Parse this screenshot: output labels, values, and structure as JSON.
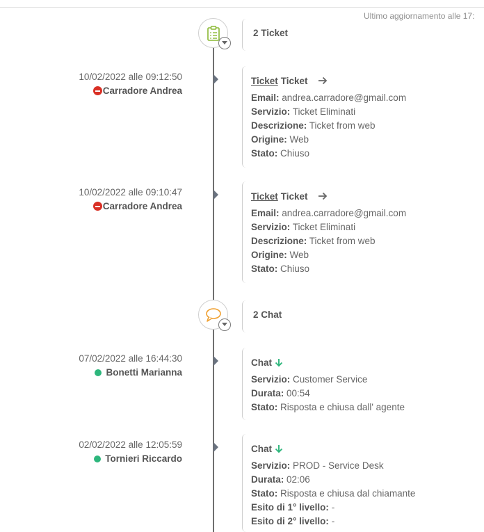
{
  "header": {
    "updated_text": "Ultimo aggiornamento alle 17:"
  },
  "sections": [
    {
      "title": "2 Ticket",
      "icon": "clipboard-list-icon",
      "icon_color": "#8ab833"
    },
    {
      "title": "2 Chat",
      "icon": "speech-bubble-icon",
      "icon_color": "#f0a030"
    }
  ],
  "tickets": [
    {
      "date": "10/02/2022 alle 09:12:50",
      "user": "Carradore Andrea",
      "link_label": "Ticket",
      "title": "Ticket",
      "fields": [
        {
          "label": "Email:",
          "value": "andrea.carradore@gmail.com"
        },
        {
          "label": "Servizio:",
          "value": "Ticket Eliminati"
        },
        {
          "label": "Descrizione:",
          "value": "Ticket from web"
        },
        {
          "label": "Origine:",
          "value": "Web"
        },
        {
          "label": "Stato:",
          "value": "Chiuso"
        }
      ]
    },
    {
      "date": "10/02/2022 alle 09:10:47",
      "user": "Carradore Andrea",
      "link_label": "Ticket",
      "title": "Ticket",
      "fields": [
        {
          "label": "Email:",
          "value": "andrea.carradore@gmail.com"
        },
        {
          "label": "Servizio:",
          "value": "Ticket Eliminati"
        },
        {
          "label": "Descrizione:",
          "value": "Ticket from web"
        },
        {
          "label": "Origine:",
          "value": "Web"
        },
        {
          "label": "Stato:",
          "value": "Chiuso"
        }
      ]
    }
  ],
  "chats": [
    {
      "date": "07/02/2022 alle 16:44:30",
      "user": "Bonetti Marianna",
      "title": "Chat",
      "fields": [
        {
          "label": "Servizio:",
          "value": "Customer Service"
        },
        {
          "label": "Durata:",
          "value": "00:54"
        },
        {
          "label": "Stato:",
          "value": "Risposta e chiusa dall' agente"
        }
      ]
    },
    {
      "date": "02/02/2022 alle 12:05:59",
      "user": "Tornieri Riccardo",
      "title": "Chat",
      "fields": [
        {
          "label": "Servizio:",
          "value": "PROD - Service Desk"
        },
        {
          "label": "Durata:",
          "value": "02:06"
        },
        {
          "label": "Stato:",
          "value": "Risposta e chiusa dal chiamante"
        },
        {
          "label": "Esito di 1° livello:",
          "value": "-"
        },
        {
          "label": "Esito di 2° livello:",
          "value": "-"
        }
      ]
    }
  ],
  "colors": {
    "blocked": "#d93025",
    "online": "#2db67c",
    "arrow_green": "#2db67c"
  }
}
